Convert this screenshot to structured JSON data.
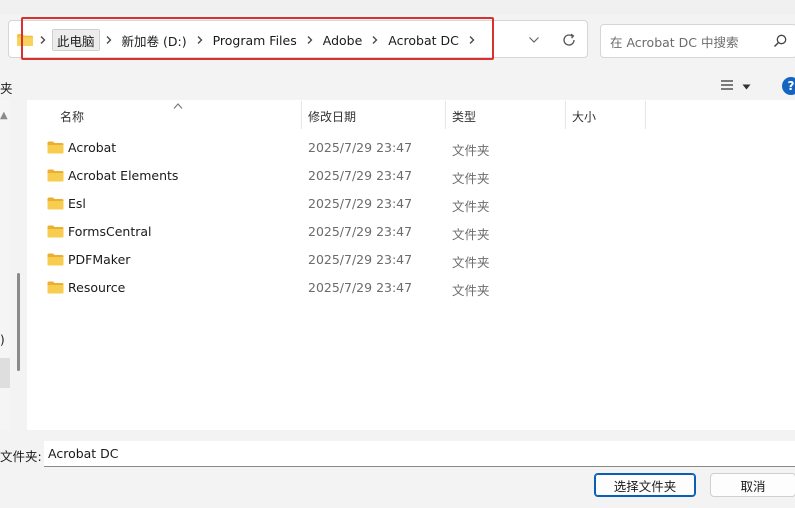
{
  "breadcrumb": [
    "此电脑",
    "新加卷 (D:)",
    "Program Files",
    "Adobe",
    "Acrobat DC"
  ],
  "search": {
    "placeholder": "在 Acrobat DC 中搜索"
  },
  "toolbar": {
    "left_label": "夹",
    "help": "?"
  },
  "nav": {
    "paren": ")"
  },
  "columns": {
    "name": "名称",
    "date": "修改日期",
    "type": "类型",
    "size": "大小"
  },
  "files": [
    {
      "name": "Acrobat",
      "date": "2025/7/29 23:47",
      "type": "文件夹"
    },
    {
      "name": "Acrobat Elements",
      "date": "2025/7/29 23:47",
      "type": "文件夹"
    },
    {
      "name": "Esl",
      "date": "2025/7/29 23:47",
      "type": "文件夹"
    },
    {
      "name": "FormsCentral",
      "date": "2025/7/29 23:47",
      "type": "文件夹"
    },
    {
      "name": "PDFMaker",
      "date": "2025/7/29 23:47",
      "type": "文件夹"
    },
    {
      "name": "Resource",
      "date": "2025/7/29 23:47",
      "type": "文件夹"
    }
  ],
  "footer": {
    "folder_label": "文件夹:",
    "folder_value": "Acrobat DC",
    "select_button": "选择文件夹",
    "cancel_button": "取消"
  },
  "colors": {
    "folder": "#f3c241",
    "highlight": "#d9312d",
    "accent": "#0a5fb4"
  }
}
